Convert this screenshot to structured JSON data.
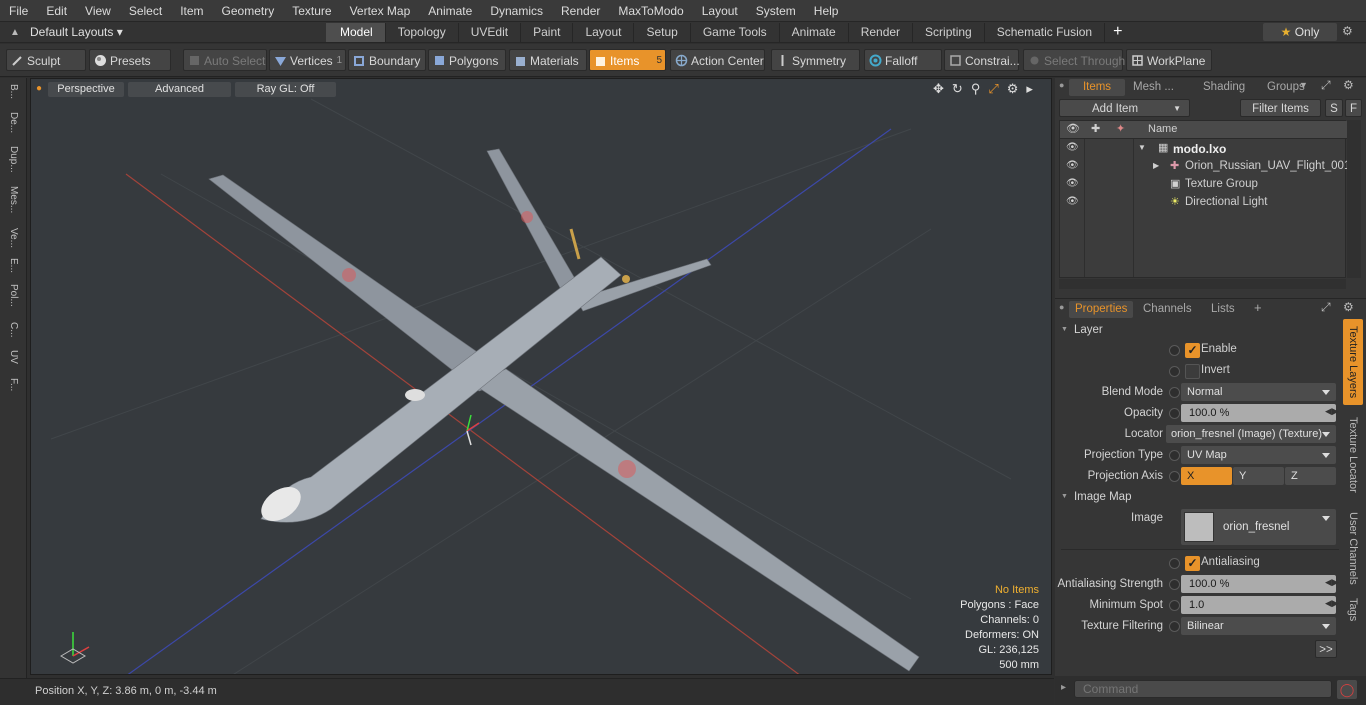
{
  "menu": [
    "File",
    "Edit",
    "View",
    "Select",
    "Item",
    "Geometry",
    "Texture",
    "Vertex Map",
    "Animate",
    "Dynamics",
    "Render",
    "MaxToModo",
    "Layout",
    "System",
    "Help"
  ],
  "layout_bar": {
    "layouts_dropdown": "Default Layouts",
    "tabs": [
      "Model",
      "Topology",
      "UVEdit",
      "Paint",
      "Layout",
      "Setup",
      "Game Tools",
      "Animate",
      "Render",
      "Scripting",
      "Schematic Fusion"
    ],
    "active_tab": "Model",
    "add": "+",
    "only": "Only"
  },
  "toolbar": {
    "sculpt": "Sculpt",
    "presets": "Presets",
    "auto_select": "Auto Select",
    "vertices": "Vertices",
    "vertices_count": "1",
    "boundary": "Boundary",
    "polygons": "Polygons",
    "materials": "Materials",
    "items": "Items",
    "items_count": "5",
    "action_center": "Action Center",
    "symmetry": "Symmetry",
    "falloff": "Falloff",
    "constraints": "Constrai...",
    "select_through": "Select Through",
    "workplane": "WorkPlane"
  },
  "left_tabs": [
    "B...",
    "De...",
    "Dup...",
    "Mes...",
    "Ve...",
    "E...",
    "Pol...",
    "C...",
    "UV",
    "F..."
  ],
  "viewport": {
    "perspective": "Perspective",
    "advanced": "Advanced",
    "raygl": "Ray GL: Off",
    "info": {
      "no_items": "No Items",
      "polygons": "Polygons : Face",
      "channels": "Channels: 0",
      "deformers": "Deformers: ON",
      "gl": "GL: 236,125",
      "scale": "500 mm"
    }
  },
  "status": "Position X, Y, Z:   3.86 m, 0 m, -3.44 m",
  "items_panel": {
    "tabs": [
      "Items",
      "Mesh ...",
      "Shading",
      "Groups"
    ],
    "add_item": "Add Item",
    "filter_items": "Filter Items",
    "s": "S",
    "f": "F",
    "name_header": "Name",
    "tree": [
      {
        "label": "modo.lxo"
      },
      {
        "label": "Orion_Russian_UAV_Flight_001"
      },
      {
        "label": "Texture Group"
      },
      {
        "label": "Directional Light"
      }
    ]
  },
  "properties": {
    "tabs": [
      "Properties",
      "Channels",
      "Lists"
    ],
    "layer_section": "Layer",
    "enable": "Enable",
    "invert": "Invert",
    "blend_mode_label": "Blend Mode",
    "blend_mode": "Normal",
    "opacity_label": "Opacity",
    "opacity": "100.0 %",
    "locator_label": "Locator",
    "locator": "orion_fresnel (Image) (Texture)",
    "projection_type_label": "Projection Type",
    "projection_type": "UV Map",
    "projection_axis_label": "Projection Axis",
    "axis": [
      "X",
      "Y",
      "Z"
    ],
    "image_map_section": "Image Map",
    "image_label": "Image",
    "image": "orion_fresnel",
    "antialiasing": "Antialiasing",
    "aa_strength_label": "Antialiasing Strength",
    "aa_strength": "100.0 %",
    "min_spot_label": "Minimum Spot",
    "min_spot": "1.0",
    "tex_filter_label": "Texture Filtering",
    "tex_filter": "Bilinear",
    "more": ">>",
    "side_tabs": [
      "Texture Layers",
      "Texture Locator",
      "User Channels",
      "Tags"
    ]
  },
  "command_placeholder": "Command",
  "colors": {
    "accent": "#e8932a",
    "viewport_bg": "#363a3e"
  }
}
